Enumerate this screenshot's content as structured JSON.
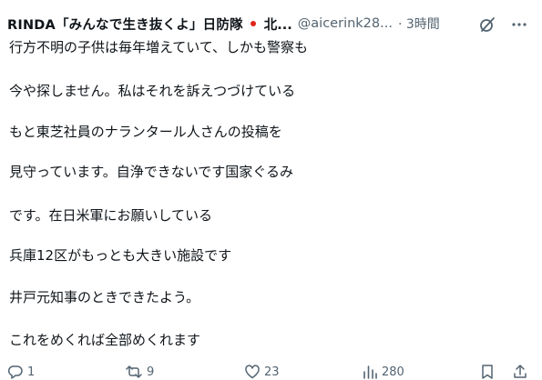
{
  "tweet": {
    "display_name": "RINDA「みんなで生き抜くよ」日防隊",
    "name_tail": "北...",
    "handle": "@aicerink28...",
    "time": "· 3時間",
    "lines": [
      "行方不明の子供は毎年増えていて、しかも警察も",
      "今や探しません。私はそれを訴えつづけている",
      "もと東芝社員のナランタール人さんの投稿を",
      "見守っています。自浄できないです国家ぐるみ",
      "です。在日米軍にお願いしている",
      "兵庫12区がもっとも大きい施設です",
      "井戸元知事のときできたよう。",
      "これをめくれば全部めくれます"
    ],
    "actions": {
      "replies": "1",
      "reposts": "9",
      "likes": "23",
      "views": "280"
    }
  },
  "colors": {
    "text": "#0f1419",
    "secondary": "#536471",
    "flag_red": "#e0241c"
  },
  "icons": {
    "flag": "japan-flag-icon",
    "grok": "grok-icon",
    "more": "more-icon",
    "reply": "reply-icon",
    "repost": "repost-icon",
    "like": "like-icon",
    "views": "views-icon",
    "bookmark": "bookmark-icon",
    "share": "share-icon"
  }
}
